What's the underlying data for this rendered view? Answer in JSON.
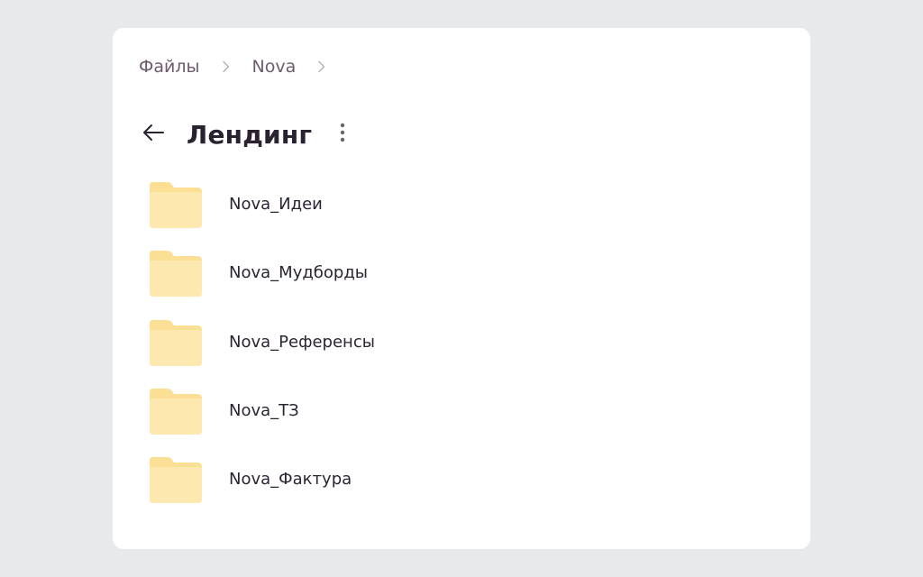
{
  "breadcrumb": {
    "items": [
      {
        "label": "Файлы"
      },
      {
        "label": "Nova"
      }
    ]
  },
  "header": {
    "title": "Лендинг",
    "back_icon": "arrow-left-icon",
    "more_icon": "more-vertical-icon"
  },
  "folders": [
    {
      "name": "Nova_Идеи"
    },
    {
      "name": "Nova_Мудборды"
    },
    {
      "name": "Nova_Референсы"
    },
    {
      "name": "Nova_ТЗ"
    },
    {
      "name": "Nova_Фактура"
    }
  ],
  "colors": {
    "background": "#e8e9ec",
    "card": "#ffffff",
    "breadcrumb_text": "#6e5b6e",
    "title_text": "#2a2230",
    "folder_back": "#fbdf95",
    "folder_front": "#fde9b0"
  }
}
